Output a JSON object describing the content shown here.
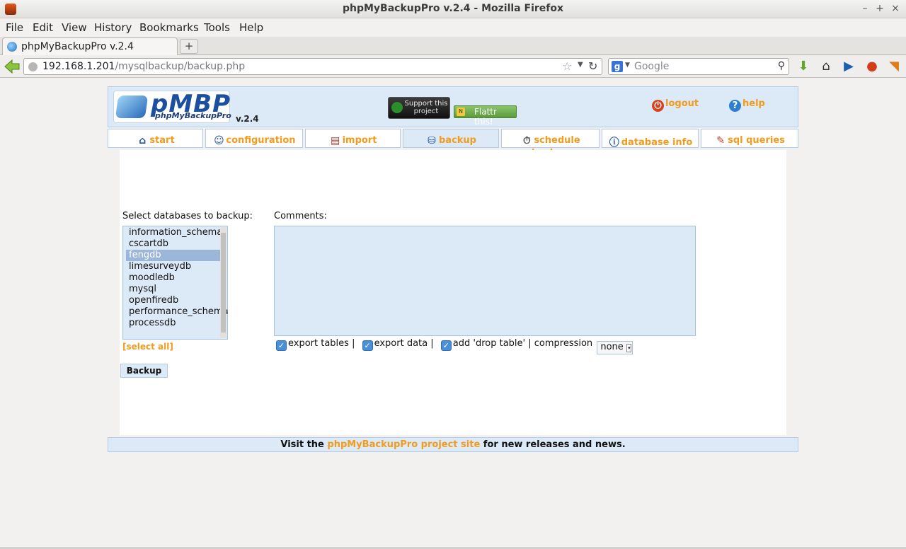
{
  "window": {
    "title": "phpMyBackupPro v.2.4 - Mozilla Firefox",
    "minimize": "–",
    "maximize": "+",
    "close": "×"
  },
  "menu": [
    "File",
    "Edit",
    "View",
    "History",
    "Bookmarks",
    "Tools",
    "Help"
  ],
  "tab": {
    "label": "phpMyBackupPro v.2.4",
    "new_tab": "+"
  },
  "urlbar": {
    "host": "192.168.1.201",
    "path": "/mysqlbackup/backup.php"
  },
  "search": {
    "placeholder": "Google"
  },
  "header": {
    "logo_big": "pMBP",
    "logo_small": "phpMyBackupPro",
    "version": "v.2.4",
    "support": "Support this project",
    "flattr": "Flattr this!",
    "logout": "logout",
    "help": "help"
  },
  "nav": [
    {
      "label": "start",
      "icon": "home-icon"
    },
    {
      "label": "configuration",
      "icon": "users-icon"
    },
    {
      "label": "import",
      "icon": "import-icon"
    },
    {
      "label": "backup",
      "icon": "backup-icon"
    },
    {
      "label": "schedule backup",
      "icon": "stopwatch-icon"
    },
    {
      "label": "database info",
      "icon": "database-info-icon"
    },
    {
      "label": "sql queries",
      "icon": "sql-queries-icon"
    }
  ],
  "form": {
    "select_label": "Select databases to backup:",
    "comments_label": "Comments:",
    "databases": [
      "information_schema",
      "cscartdb",
      "fengdb",
      "limesurveydb",
      "moodledb",
      "mysql",
      "openfiredb",
      "performance_schema",
      "processdb"
    ],
    "selected_database": "fengdb",
    "select_all": "[select all]",
    "backup_button": "Backup",
    "opt_export_tables": "export tables |",
    "opt_export_data": "export data |",
    "opt_drop_table": "add 'drop table' | compression",
    "compression_value": "none"
  },
  "footer": {
    "prefix": "Visit the",
    "link": "phpMyBackupPro project site",
    "suffix": "for new releases and news."
  },
  "colors": {
    "accent": "#f29b1d",
    "panel_blue": "#dce9f6",
    "border_blue": "#b4ccea"
  }
}
